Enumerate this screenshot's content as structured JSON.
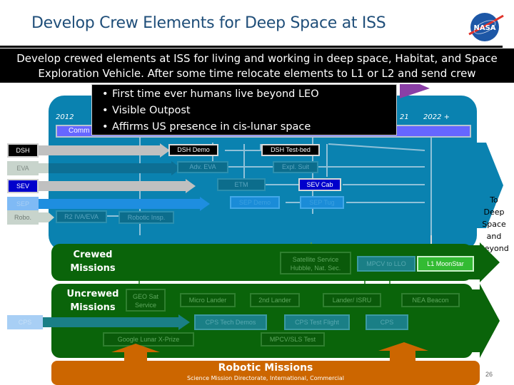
{
  "header": {
    "title": "Develop Crew Elements for Deep Space at ISS",
    "logo_text": "NASA",
    "logo_icon": "nasa-meatball-logo"
  },
  "banner": {
    "line1": "Develop crewed elements at ISS for living and working in deep space, Habitat, and Space",
    "line2": "Exploration Vehicle.   After some time relocate elements to L1 or L2 and send crew"
  },
  "callout": {
    "bullets": [
      "First time ever humans live beyond LEO",
      "Visible Outpost",
      "Affirms US presence in cis-lunar space"
    ]
  },
  "timeline": {
    "start_year": "2012",
    "end_year_partial": "21",
    "end_year": "2022 +",
    "commit_label_partial": "Comm"
  },
  "rows": [
    {
      "label": "DSH",
      "style": "dark"
    },
    {
      "label": "EVA",
      "style": "gray"
    },
    {
      "label": "SEV",
      "style": "blue"
    },
    {
      "label": "SEP",
      "style": "lightblue"
    },
    {
      "label": "Robo.",
      "style": "gray"
    }
  ],
  "boxes": {
    "dsh_demo": "DSH Demo",
    "dsh_testbed": "DSH Test-bed",
    "adv_eva": "Adv. EVA",
    "expl_suit": "Expl. Suit",
    "etm": "ETM",
    "sev_cab": "SEV Cab",
    "sep_demo": "SEP Demo",
    "sep_tug": "SEP Tug",
    "r2_iva_eva": "R2 IVA/EVA",
    "robotic_insp": "Robotic Insp."
  },
  "deep_space": {
    "lines": [
      "To",
      "Deep",
      "Space",
      "and",
      "Beyond"
    ]
  },
  "crewed": {
    "label_line1": "Crewed",
    "label_line2": "Missions",
    "satellite_service_line1": "Satellite Service",
    "satellite_service_line2": "Hubble, Nat. Sec.",
    "mpcv_to_llo": "MPCV to LLO",
    "l1_moonstar": "L1 MoonStar"
  },
  "uncrewed": {
    "label_line1": "Uncrewed",
    "label_line2": "Missions",
    "geo_sat_line1": "GEO Sat",
    "geo_sat_line2": "Service",
    "micro_lander": "Micro Lander",
    "second_lander": "2nd Lander",
    "lander_isru": "Lander/ ISRU",
    "nea_beacon": "NEA Beacon",
    "cps_row_label": "CPS",
    "cps_tech_demos": "CPS Tech Demos",
    "cps_test_flight": "CPS Test Flight",
    "cps": "CPS",
    "google_lunar": "Google Lunar X-Prize",
    "mpcv_sls_test": "MPCV/SLS Test"
  },
  "robotic": {
    "title": "Robotic Missions",
    "subtitle": "Science Mission Directorate, International, Commercial"
  },
  "footer": {
    "page_number": "26"
  },
  "colors": {
    "title": "#1f4e79",
    "blue_panel": "#0a82b0",
    "timeline_bar": "#6666ff",
    "green_panel": "#0a640a",
    "orange_panel": "#cc6600",
    "sev_blue": "#0000cc",
    "moonstar_green": "#33bb33"
  }
}
